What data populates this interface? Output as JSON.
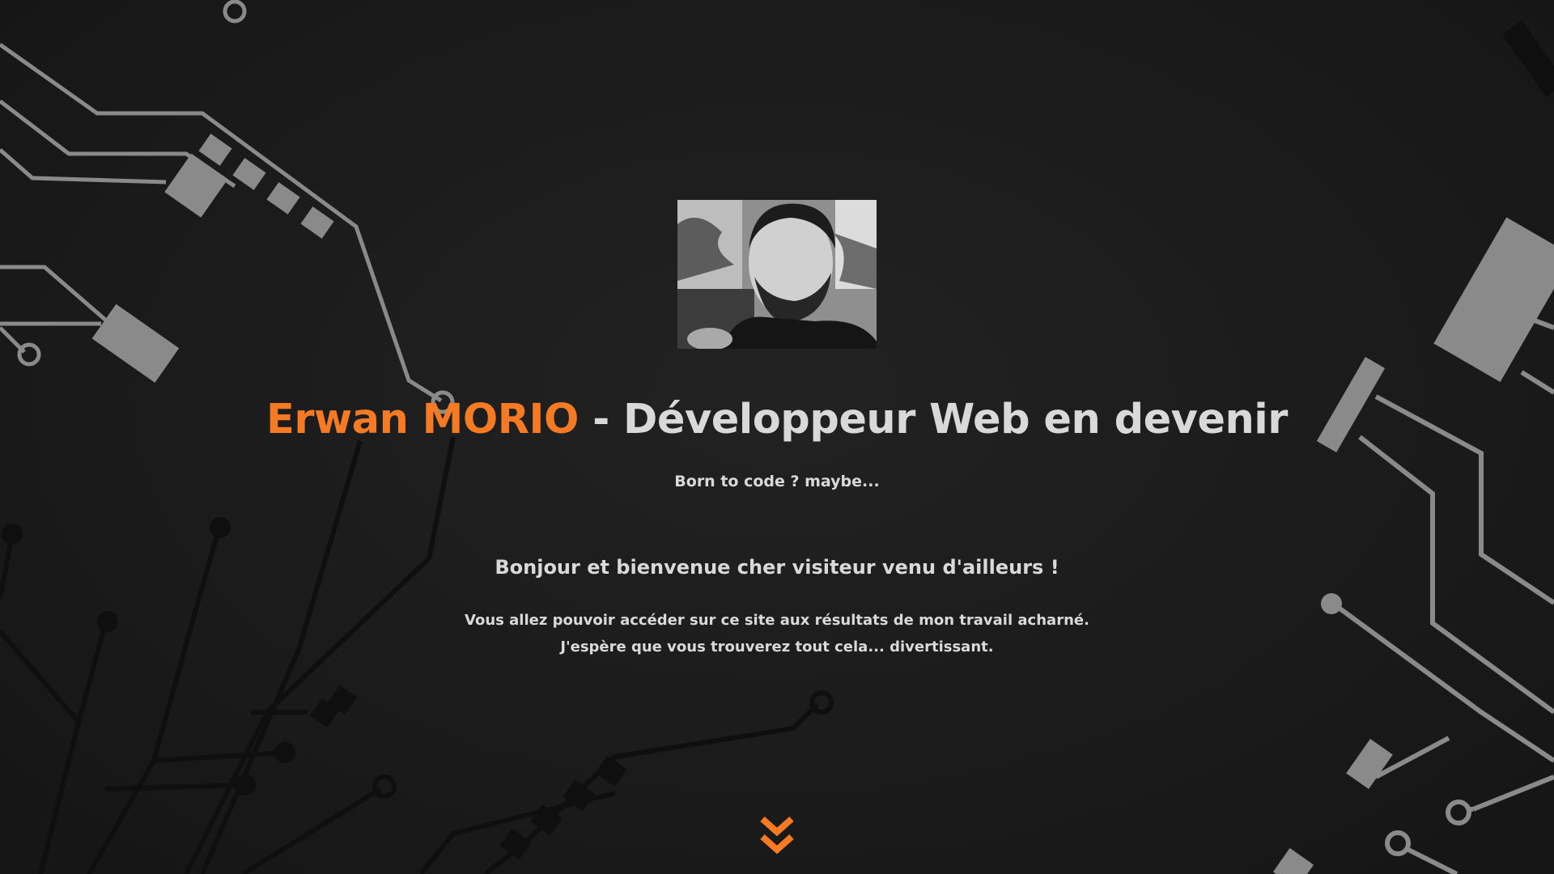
{
  "hero": {
    "name": "Erwan MORIO",
    "separator": " - ",
    "role": "Développeur Web en devenir",
    "tagline": "Born to code ? maybe...",
    "welcome": "Bonjour et bienvenue cher visiteur venu d'ailleurs !",
    "intro_line1": "Vous allez pouvoir accéder sur ce site aux résultats de mon travail acharné.",
    "intro_line2": "J'espère que vous trouverez tout cela... divertissant."
  },
  "colors": {
    "accent": "#f47a24",
    "text": "#d9d9d9",
    "background": "#1b1b1b",
    "circuit_light": "#8a8a8a",
    "circuit_dark": "#0f0f0f"
  },
  "icons": {
    "scroll_down": "double-chevron-down-icon",
    "avatar": "profile-photo"
  }
}
